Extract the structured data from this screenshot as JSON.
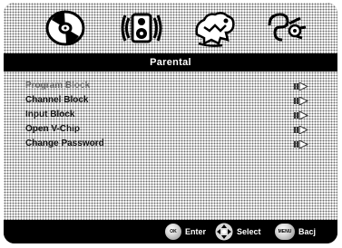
{
  "top_icons": [
    {
      "name": "disc-icon"
    },
    {
      "name": "speaker-icon"
    },
    {
      "name": "dragon-icon"
    },
    {
      "name": "settings-glyph-icon"
    }
  ],
  "title": "Parental",
  "menu": {
    "items": [
      {
        "label": "Program Block",
        "selected": true
      },
      {
        "label": "Channel Block"
      },
      {
        "label": "Input Block"
      },
      {
        "label": "Open V-Chip"
      },
      {
        "label": "Change Password"
      }
    ]
  },
  "footer": {
    "ok_button": "OK",
    "enter_label": "Enter",
    "select_label": "Select",
    "menu_button": "MENU",
    "back_label": "Bacj"
  }
}
